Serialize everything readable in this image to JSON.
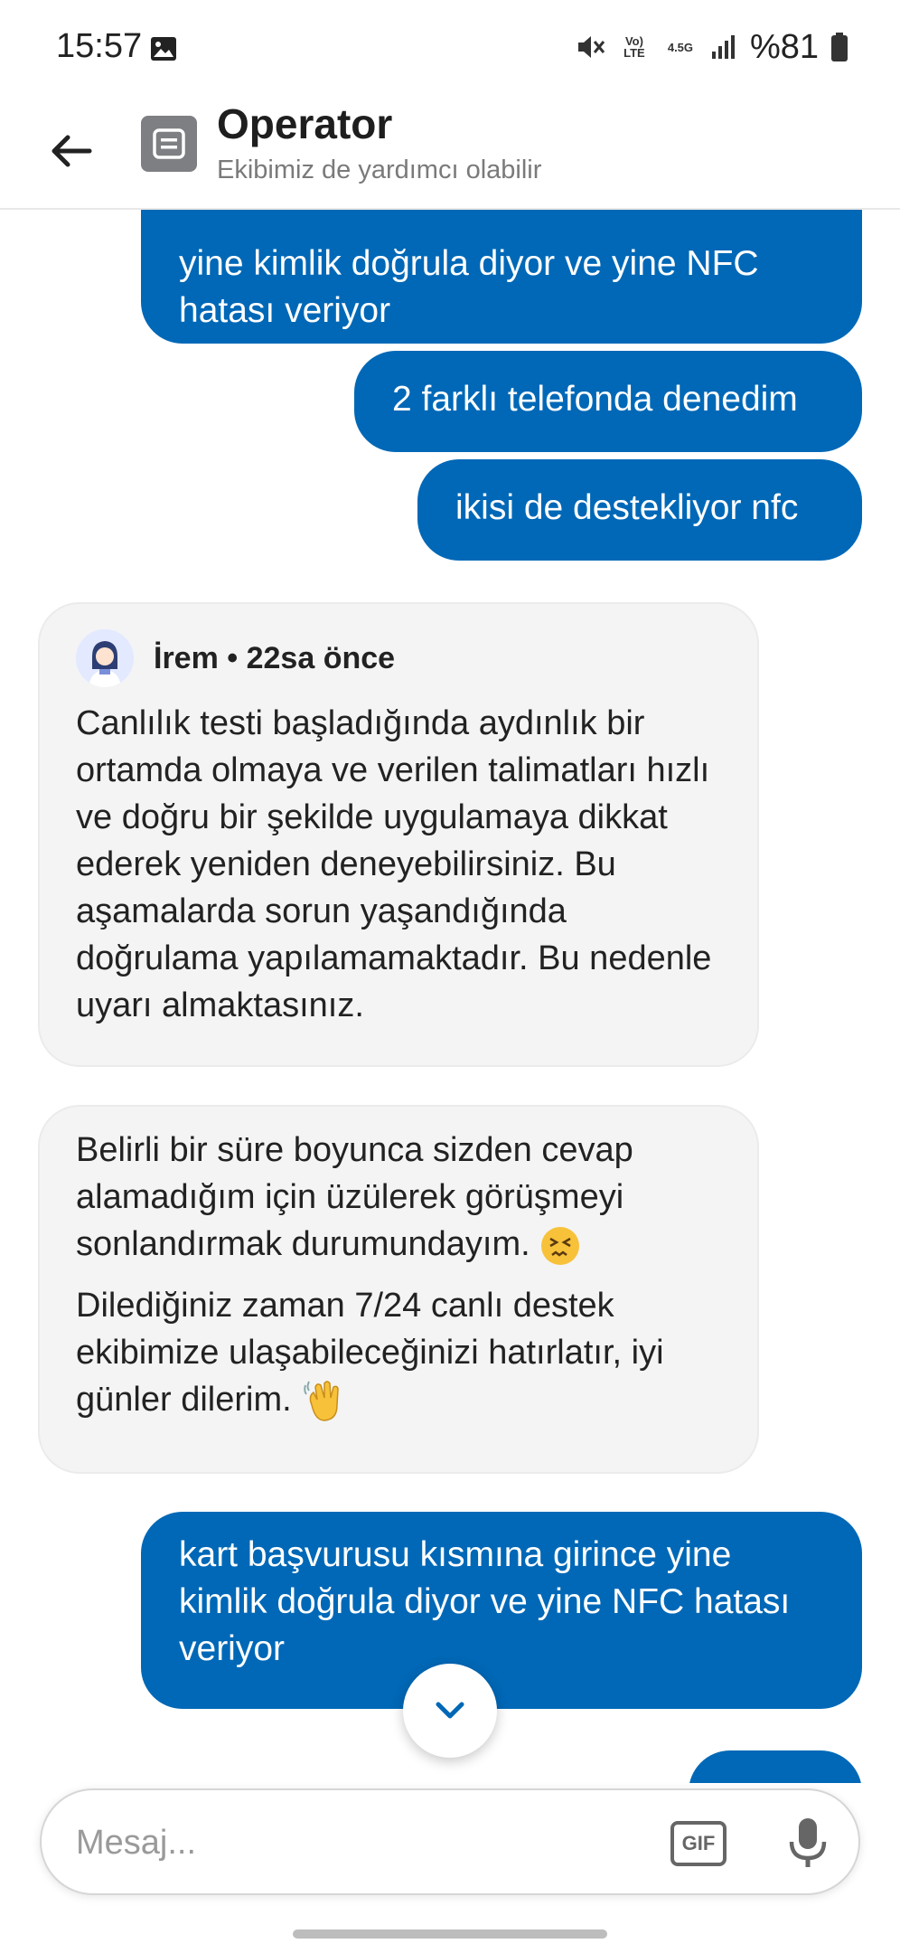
{
  "status_bar": {
    "time": "15:57",
    "network": "4.5G",
    "volte": "Vo) LTE",
    "battery": "%81"
  },
  "header": {
    "title": "Operator",
    "subtitle": "Ekibimiz de yardımcı olabilir"
  },
  "messages": {
    "out_1": "yine kimlik doğrula diyor ve yine NFC hatası veriyor",
    "out_2": "2 farklı telefonda denedim",
    "out_3": "ikisi de destekliyor nfc",
    "in_1": {
      "sender": "İrem • 22sa önce",
      "text": "Canlılık testi başladığında aydınlık bir ortamda olmaya ve verilen talimatları hızlı ve doğru bir şekilde uygulamaya dikkat ederek yeniden deneyebilirsiniz. Bu aşamalarda sorun yaşandığında doğrulama yapılamamaktadır. Bu nedenle uyarı almaktasınız."
    },
    "in_2": {
      "paragraph_1": "Belirli bir süre boyunca sizden cevap alamadığım için üzülerek görüşmeyi sonlandırmak durumundayım.",
      "paragraph_2": "Dilediğiniz zaman 7/24 canlı destek ekibimize ulaşabileceğinizi hatırlatır, iyi günler dilerim."
    },
    "out_4": "kart başvurusu kısmına girince yine kimlik doğrula diyor ve yine NFC hatası veriyor"
  },
  "composer": {
    "placeholder": "Mesaj...",
    "gif_label": "GIF"
  },
  "colors": {
    "outgoing_bubble": "#0068b7",
    "incoming_bubble": "#f4f4f5"
  }
}
